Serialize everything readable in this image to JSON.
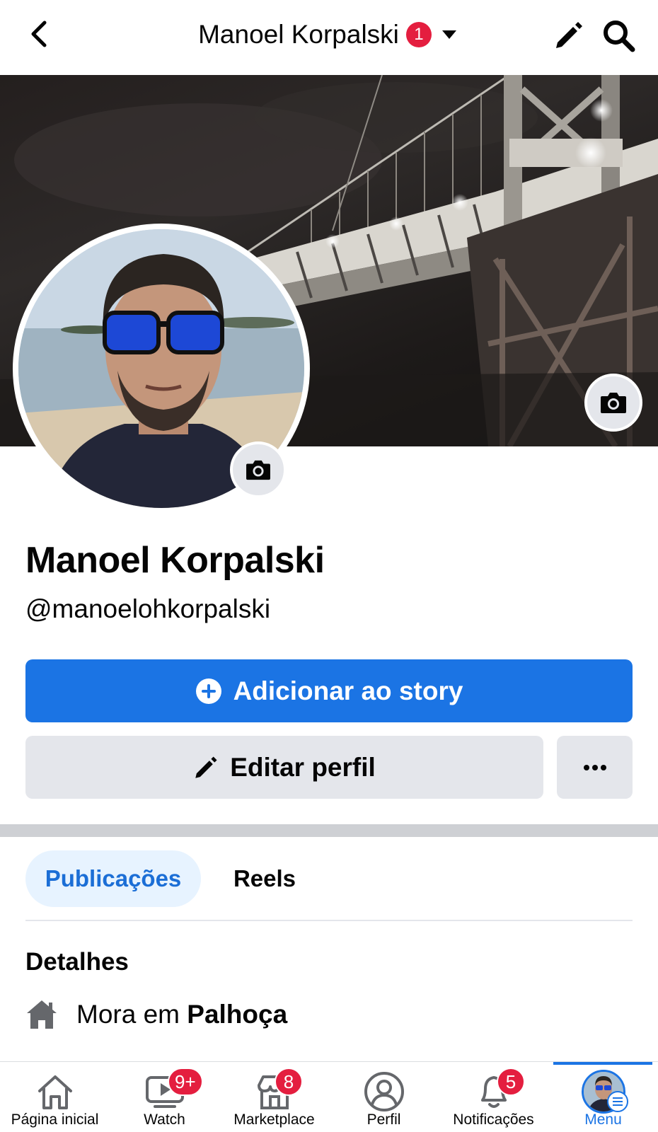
{
  "topbar": {
    "title": "Manoel Korpalski",
    "notification_count": "1"
  },
  "profile": {
    "name": "Manoel Korpalski",
    "handle": "@manoelohkorpalski"
  },
  "actions": {
    "add_story_label": "Adicionar ao story",
    "edit_profile_label": "Editar perfil"
  },
  "tabs": [
    {
      "label": "Publicações",
      "active": true
    },
    {
      "label": "Reels",
      "active": false
    }
  ],
  "details": {
    "title": "Detalhes",
    "lives_in_prefix": "Mora em",
    "lives_in_city": "Palhoça"
  },
  "bottom_nav": [
    {
      "label": "Página inicial",
      "icon": "home-icon",
      "badge": ""
    },
    {
      "label": "Watch",
      "icon": "video-icon",
      "badge": "9+"
    },
    {
      "label": "Marketplace",
      "icon": "marketplace-icon",
      "badge": "8"
    },
    {
      "label": "Perfil",
      "icon": "profile-icon",
      "badge": ""
    },
    {
      "label": "Notificações",
      "icon": "bell-icon",
      "badge": "5"
    },
    {
      "label": "Menu",
      "icon": "menu-avatar",
      "badge": "",
      "active": true
    }
  ],
  "colors": {
    "accent": "#1b74e4",
    "badge": "#e41e3f",
    "button_gray": "#e4e6eb",
    "active_tab_bg": "#e7f3ff"
  }
}
